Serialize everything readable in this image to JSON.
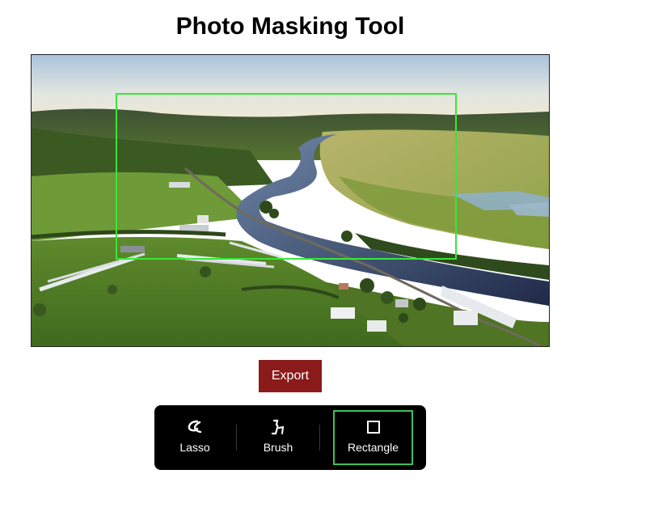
{
  "page": {
    "title": "Photo Masking Tool"
  },
  "canvas": {
    "image_description_icon": "aerial-landscape-photo",
    "selection_color": "#39e639"
  },
  "actions": {
    "export_label": "Export",
    "export_color": "#8b1a1a"
  },
  "toolbar": {
    "tools": [
      {
        "label": "Lasso",
        "icon": "lasso-icon",
        "selected": false
      },
      {
        "label": "Brush",
        "icon": "brush-icon",
        "selected": false
      },
      {
        "label": "Rectangle",
        "icon": "rectangle-icon",
        "selected": true
      }
    ],
    "selected_border_color": "#3fbf5c"
  }
}
